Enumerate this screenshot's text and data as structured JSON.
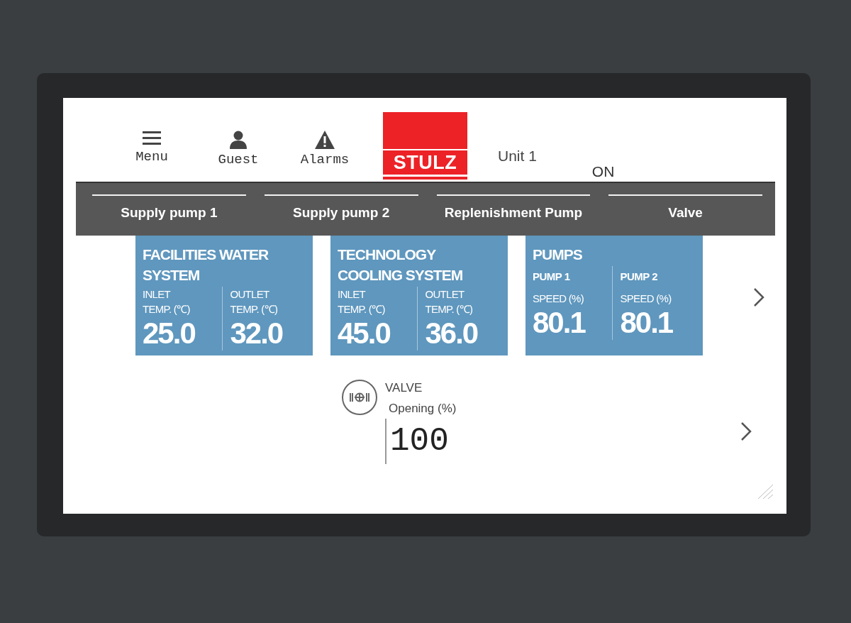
{
  "header": {
    "buttons": [
      {
        "kind": "menu",
        "label": "Menu"
      },
      {
        "kind": "user",
        "label": "Guest"
      },
      {
        "kind": "alarm",
        "label": "Alarms"
      }
    ],
    "logo": "STULZ",
    "unit": "Unit 1",
    "status": "ON"
  },
  "tabs": [
    {
      "label": "Supply pump 1"
    },
    {
      "label": "Supply pump 2"
    },
    {
      "label": "Replenishment Pump"
    },
    {
      "label": "Valve"
    }
  ],
  "cards": [
    {
      "title": "FACILITIES WATER SYSTEM",
      "readings": [
        {
          "label_lines": [
            "INLET",
            "TEMP. (℃)"
          ],
          "value": "25.0"
        },
        {
          "label_lines": [
            "OUTLET",
            "TEMP. (℃)"
          ],
          "value": "32.0"
        }
      ]
    },
    {
      "title": "TECHNOLOGY COOLING SYSTEM",
      "readings": [
        {
          "label_lines": [
            "INLET",
            "TEMP. (℃)"
          ],
          "value": "45.0"
        },
        {
          "label_lines": [
            "OUTLET",
            "TEMP. (℃)"
          ],
          "value": "36.0"
        }
      ]
    },
    {
      "title": "PUMPS",
      "readings": [
        {
          "name": "PUMP 1",
          "label_lines": [
            "SPEED (%)"
          ],
          "value": "80.1"
        },
        {
          "name": "PUMP 2",
          "label_lines": [
            "SPEED (%)"
          ],
          "value": "80.1"
        }
      ]
    }
  ],
  "valve": {
    "title": "VALVE",
    "label": "Opening (%)",
    "value": "100"
  }
}
